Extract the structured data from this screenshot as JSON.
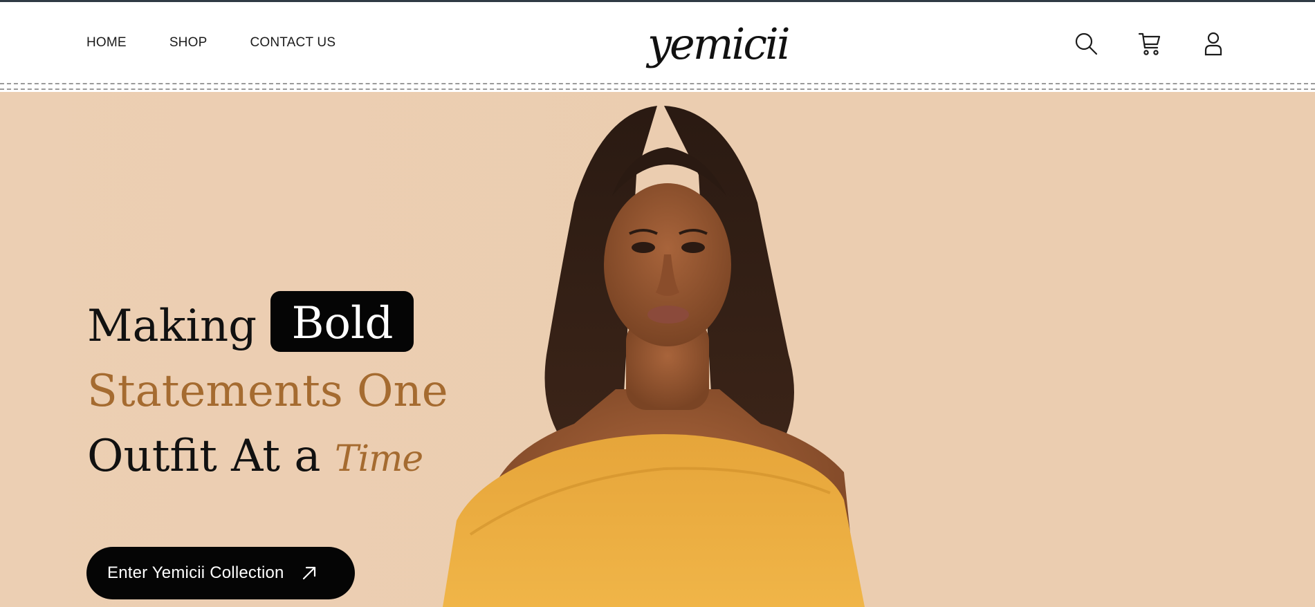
{
  "header": {
    "nav": [
      {
        "label": "HOME"
      },
      {
        "label": "SHOP"
      },
      {
        "label": "CONTACT US"
      }
    ],
    "logo_text": "yemicii",
    "icons": [
      "search-icon",
      "cart-icon",
      "user-icon"
    ]
  },
  "hero": {
    "headline": {
      "word1": "Making",
      "chip": "Bold",
      "line2": "Statements One",
      "line3": "Outfit At a",
      "script_word": "Time"
    },
    "cta_label": "Enter Yemicii Collection"
  },
  "colors": {
    "accent": "#a56b30",
    "hero_bg": "#ebcdb0",
    "dark": "#050505",
    "dress": "#f0b548"
  }
}
